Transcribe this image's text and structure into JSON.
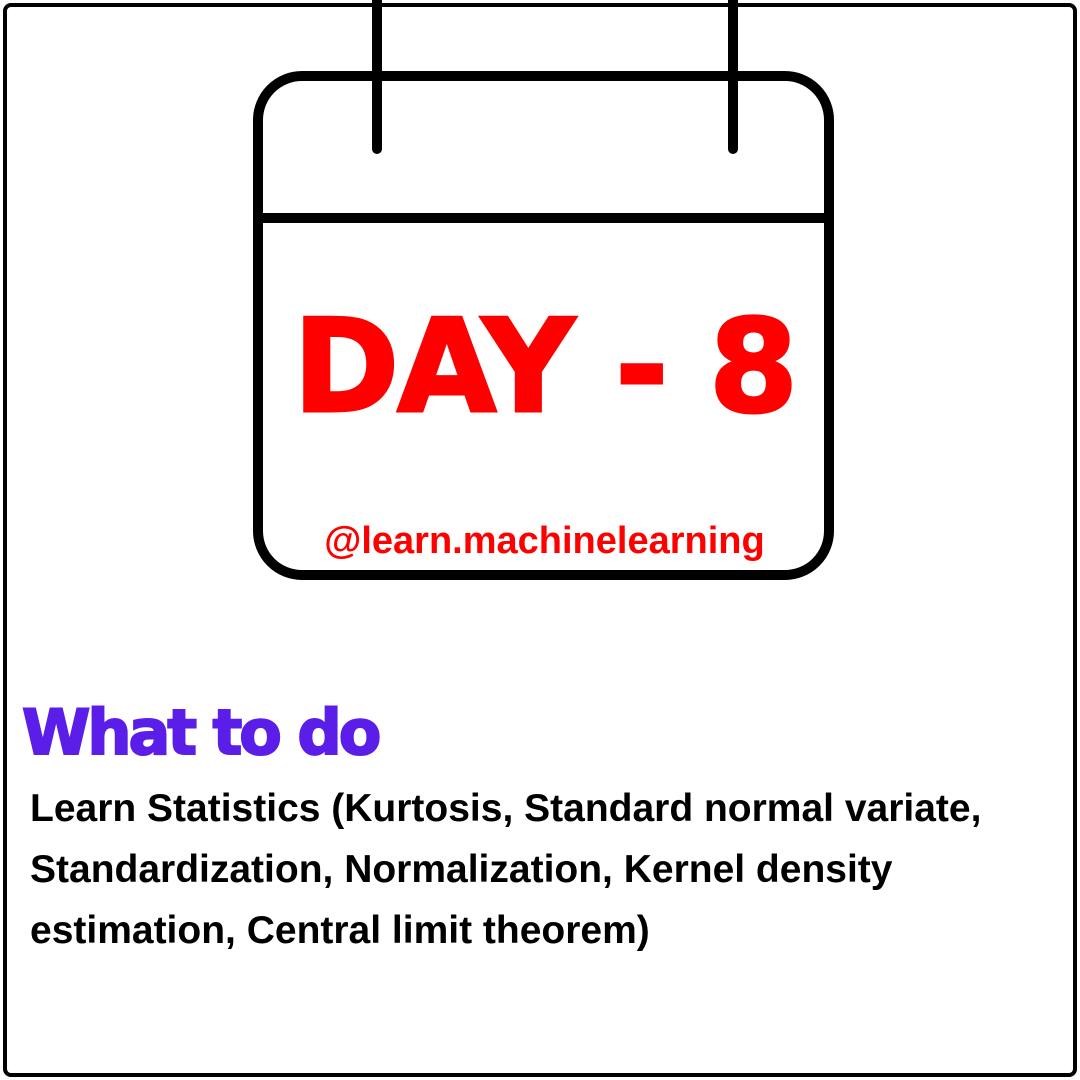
{
  "calendar": {
    "day_label": "DAY - 8",
    "handle": "@learn.machinelearning"
  },
  "section": {
    "heading": "What to do",
    "body": "Learn Statistics (Kurtosis, Standard normal variate, Standardization, Normalization, Kernel density estimation, Central limit theorem)"
  },
  "colors": {
    "accent_red": "#ff0000",
    "heading_purple": "#5b1ee8",
    "outline": "#000000",
    "background": "#ffffff"
  },
  "icons": {
    "calendar": "calendar-icon"
  }
}
